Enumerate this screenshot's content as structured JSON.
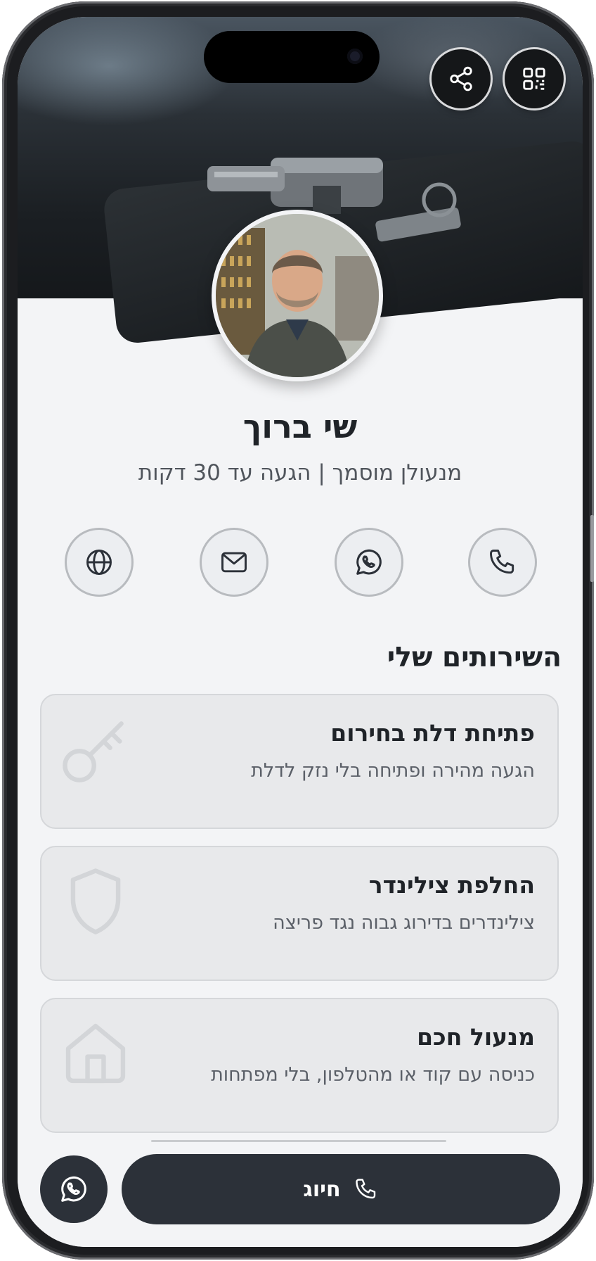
{
  "profile": {
    "name": "שי ברוך",
    "subtitle": "מנעולן מוסמך | הגעה עד 30 דקות"
  },
  "header": {
    "share_icon": "share-icon",
    "qr_icon": "qr-code-icon"
  },
  "contacts": [
    {
      "icon": "phone-icon"
    },
    {
      "icon": "whatsapp-icon"
    },
    {
      "icon": "mail-icon"
    },
    {
      "icon": "globe-icon"
    }
  ],
  "services": {
    "title": "השירותים שלי",
    "items": [
      {
        "title": "פתיחת דלת בחירום",
        "description": "הגעה מהירה ופתיחה בלי נזק לדלת",
        "icon": "key-icon"
      },
      {
        "title": "החלפת צילינדר",
        "description": "צילינדרים בדירוג גבוה נגד פריצה",
        "icon": "shield-icon"
      },
      {
        "title": "מנעול חכם",
        "description": "כניסה עם קוד או מהטלפון, בלי מפתחות",
        "icon": "home-icon"
      }
    ]
  },
  "bottom": {
    "call_label": "חיוג",
    "whatsapp_icon": "whatsapp-icon"
  },
  "colors": {
    "dark": "#2c3139",
    "background": "#f3f4f6",
    "card": "#e8e9eb"
  }
}
